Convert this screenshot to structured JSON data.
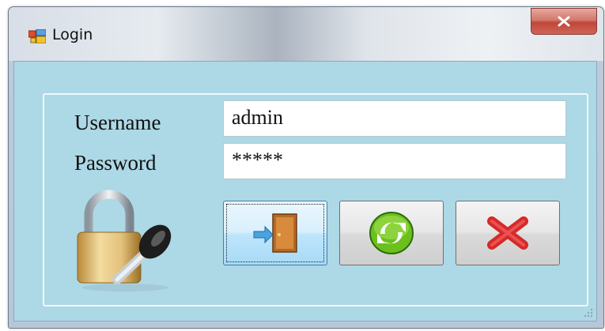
{
  "window": {
    "title": "Login",
    "icons": {
      "app": "window-app-icon",
      "close": "close-x-icon"
    }
  },
  "form": {
    "username_label": "Username",
    "username_value": "admin",
    "password_label": "Password",
    "password_value": "*****"
  },
  "buttons": [
    {
      "name": "login",
      "icon": "door-enter-icon"
    },
    {
      "name": "reset",
      "icon": "refresh-icon"
    },
    {
      "name": "exit",
      "icon": "red-x-icon"
    }
  ],
  "colors": {
    "client_background": "#add8e6",
    "close_button": "#c8503f",
    "refresh_green": "#6cc01e",
    "exit_red": "#d42a2a"
  }
}
